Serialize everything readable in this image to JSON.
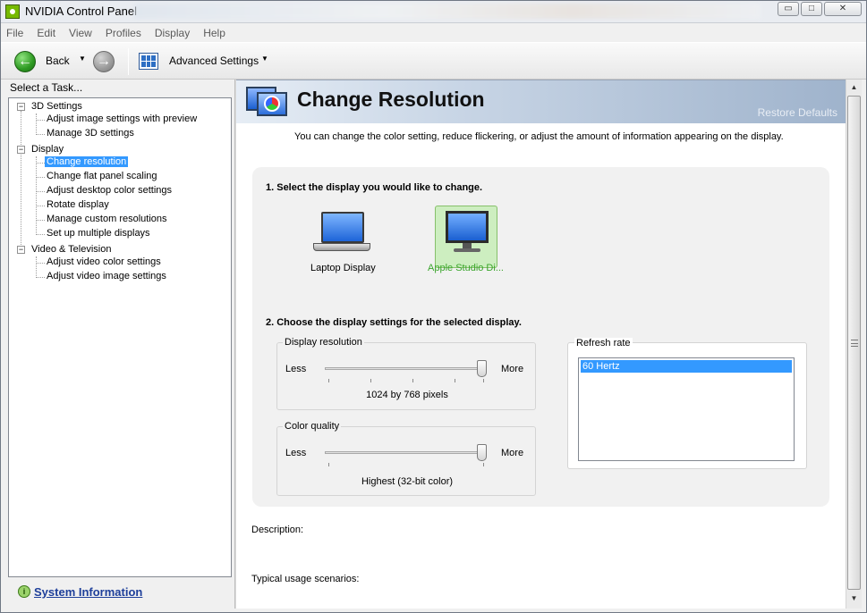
{
  "window": {
    "title": "NVIDIA Control Panel",
    "controls": {
      "minimize": "▭",
      "maximize": "□",
      "close": "✕"
    }
  },
  "menubar": {
    "items": [
      "File",
      "Edit",
      "View",
      "Profiles",
      "Display",
      "Help"
    ]
  },
  "toolbar": {
    "back_label": "Back",
    "back_dropdown": "▼",
    "back_icon": "back-arrow-icon",
    "forward_icon": "forward-arrow-icon",
    "advanced_label": "Advanced Settings",
    "advanced_dropdown": "▼"
  },
  "task_pane": {
    "header": "Select a Task...",
    "tree": [
      {
        "label": "3D Settings",
        "level": 0,
        "children": [
          {
            "label": "Adjust image settings with preview"
          },
          {
            "label": "Manage 3D settings"
          }
        ]
      },
      {
        "label": "Display",
        "level": 0,
        "children": [
          {
            "label": "Change resolution",
            "selected": true
          },
          {
            "label": "Change flat panel scaling"
          },
          {
            "label": "Adjust desktop color settings"
          },
          {
            "label": "Rotate display"
          },
          {
            "label": "Manage custom resolutions"
          },
          {
            "label": "Set up multiple displays"
          }
        ]
      },
      {
        "label": "Video & Television",
        "level": 0,
        "children": [
          {
            "label": "Adjust video color settings"
          },
          {
            "label": "Adjust video image settings"
          }
        ]
      }
    ],
    "toggle_glyph": "−",
    "system_info_label": "System Information",
    "system_info_icon": "info-icon"
  },
  "page": {
    "title": "Change Resolution",
    "restore_defaults": "Restore Defaults",
    "intro": "You can change the color setting, reduce flickering, or adjust the amount of information appearing on the display.",
    "step1_title": "1. Select the display you would like to change.",
    "displays": [
      {
        "label": "Laptop Display",
        "icon": "laptop-icon",
        "selected": false
      },
      {
        "label": "Apple Studio Di...",
        "icon": "monitor-icon",
        "selected": true
      }
    ],
    "step2_title": "2. Choose the display settings for the selected display.",
    "resolution": {
      "title": "Display resolution",
      "less": "Less",
      "more": "More",
      "value": "1024 by 768 pixels",
      "level": 1.0
    },
    "color_quality": {
      "title": "Color quality",
      "less": "Less",
      "more": "More",
      "value": "Highest (32-bit color)",
      "level": 1.0
    },
    "refresh_rate": {
      "title": "Refresh rate",
      "options": [
        "60 Hertz"
      ],
      "selected": "60 Hertz"
    },
    "description_label": "Description:",
    "usage_label": "Typical usage scenarios:"
  },
  "scrollbar": {
    "up": "▲",
    "down": "▼"
  },
  "colors": {
    "selection": "#3399ff",
    "selected_display_text": "#3aa52b",
    "link": "#1e3f9a",
    "banner": "#9fb3cc"
  }
}
